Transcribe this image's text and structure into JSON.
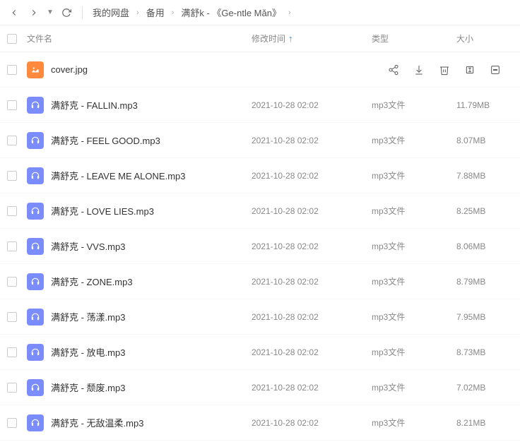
{
  "breadcrumb": [
    "我的网盘",
    "备用",
    "满舒k - 《Ge-ntle Măn》"
  ],
  "columns": {
    "name": "文件名",
    "modified": "修改时间",
    "type": "类型",
    "size": "大小"
  },
  "files": [
    {
      "name": "cover.jpg",
      "modified": "",
      "type": "",
      "size": "",
      "icon": "jpg",
      "selected": true
    },
    {
      "name": "满舒克 - FALLIN.mp3",
      "modified": "2021-10-28 02:02",
      "type": "mp3文件",
      "size": "11.79MB",
      "icon": "mp3"
    },
    {
      "name": "满舒克 - FEEL GOOD.mp3",
      "modified": "2021-10-28 02:02",
      "type": "mp3文件",
      "size": "8.07MB",
      "icon": "mp3"
    },
    {
      "name": "满舒克 - LEAVE ME ALONE.mp3",
      "modified": "2021-10-28 02:02",
      "type": "mp3文件",
      "size": "7.88MB",
      "icon": "mp3"
    },
    {
      "name": "满舒克 - LOVE LIES.mp3",
      "modified": "2021-10-28 02:02",
      "type": "mp3文件",
      "size": "8.25MB",
      "icon": "mp3"
    },
    {
      "name": "满舒克 - VVS.mp3",
      "modified": "2021-10-28 02:02",
      "type": "mp3文件",
      "size": "8.06MB",
      "icon": "mp3"
    },
    {
      "name": "满舒克 - ZONE.mp3",
      "modified": "2021-10-28 02:02",
      "type": "mp3文件",
      "size": "8.79MB",
      "icon": "mp3"
    },
    {
      "name": "满舒克 - 荡漾.mp3",
      "modified": "2021-10-28 02:02",
      "type": "mp3文件",
      "size": "7.95MB",
      "icon": "mp3"
    },
    {
      "name": "满舒克 - 放电.mp3",
      "modified": "2021-10-28 02:02",
      "type": "mp3文件",
      "size": "8.73MB",
      "icon": "mp3"
    },
    {
      "name": "满舒克 - 颓废.mp3",
      "modified": "2021-10-28 02:02",
      "type": "mp3文件",
      "size": "7.02MB",
      "icon": "mp3"
    },
    {
      "name": "满舒克 - 无敌温柔.mp3",
      "modified": "2021-10-28 02:02",
      "type": "mp3文件",
      "size": "8.21MB",
      "icon": "mp3"
    }
  ]
}
